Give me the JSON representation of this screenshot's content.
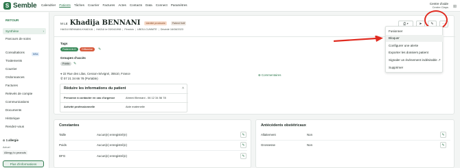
{
  "app": {
    "logo_text": "Semble",
    "logo_letter": "S"
  },
  "nav": [
    "Calendrier",
    "Patients",
    "Tâches",
    "Courrier",
    "Factures",
    "Actes",
    "Contacts",
    "Data",
    "Connect",
    "Paramètres"
  ],
  "nav_active": "Patients",
  "help": {
    "title": "Centre d'aide",
    "subtitle": "Centre Claps"
  },
  "sidebar": {
    "back": "RETOUR",
    "items": [
      "Synthèse",
      "Parcours de soins",
      "Consultations",
      "Traitements",
      "Courrier",
      "Ordonnances",
      "Factures",
      "Relevés de compte",
      "Communications",
      "Documents",
      "Historique",
      "Rendez-vous"
    ],
    "active": "Synthèse",
    "beta_badge": "bêta",
    "allergy_title": "1 allergie",
    "allergy_section": "Actuel",
    "allergy_item": "Allergy to peanuts",
    "more_info": "Plus d'informations"
  },
  "patient": {
    "civility": "M LE",
    "name": "Khadija BENNANI",
    "tag_identity": "Identité provisoire",
    "tag_status": "Patient fictif",
    "meta": [
      "HAGUI BENNANI-KHADIJA",
      "HAGUI le 03/04/1998",
      "Féminin",
      "UBOU-CUMMTE",
      "Décédé 16/08/2023"
    ],
    "tags_label": "Tags",
    "tags": [
      "Patient ALD",
      "Diffamine"
    ],
    "access_label": "Groupes d'accès",
    "access_group": "Public",
    "address": "22 Rue des Lilas, Cesson-Sévigné, 35510, France",
    "phone": "07 21 34 66 78 (Portable)",
    "comments_link": "Commentaires"
  },
  "reduce": {
    "title": "Réduire les informations du patient",
    "rows": [
      {
        "key": "Personne à contacter en cas d'urgence",
        "value": "Ahmed Bennani - 06 12 34 56 78"
      },
      {
        "key": "Activité professionnelle",
        "value": "Aide maternelle"
      }
    ]
  },
  "dropdown": {
    "items": [
      "Fusionner",
      "Bloquer",
      "Configurer une alerte",
      "Exporter les dossiers patient",
      "Signaler un événement indésirable ↗",
      "Supprimer"
    ],
    "hovered": "Bloquer"
  },
  "constantes": {
    "title": "Constantes",
    "rows": [
      {
        "label": "Taille",
        "value": "Aucun(e) enregistré(e)"
      },
      {
        "label": "Poids",
        "value": "Aucun(e) enregistré(e)"
      },
      {
        "label": "DFG",
        "value": "Aucun(e) enregistré(e)"
      }
    ]
  },
  "antecedents": {
    "title": "Antécédents obstétricaux",
    "rows": [
      {
        "label": "Allaitement",
        "value": "Non"
      },
      {
        "label": "Grossesse",
        "value": "Non"
      }
    ]
  },
  "icons": {
    "pencil": "pencil-icon",
    "send": "send-icon",
    "more": "more-icon",
    "grid": "grid-icon",
    "location": "location-icon",
    "phone": "phone-icon",
    "comment": "comment-icon",
    "chevron": "chevron-right-icon"
  },
  "colors": {
    "accent": "#2f7a4e",
    "highlight": "#e02b20"
  }
}
